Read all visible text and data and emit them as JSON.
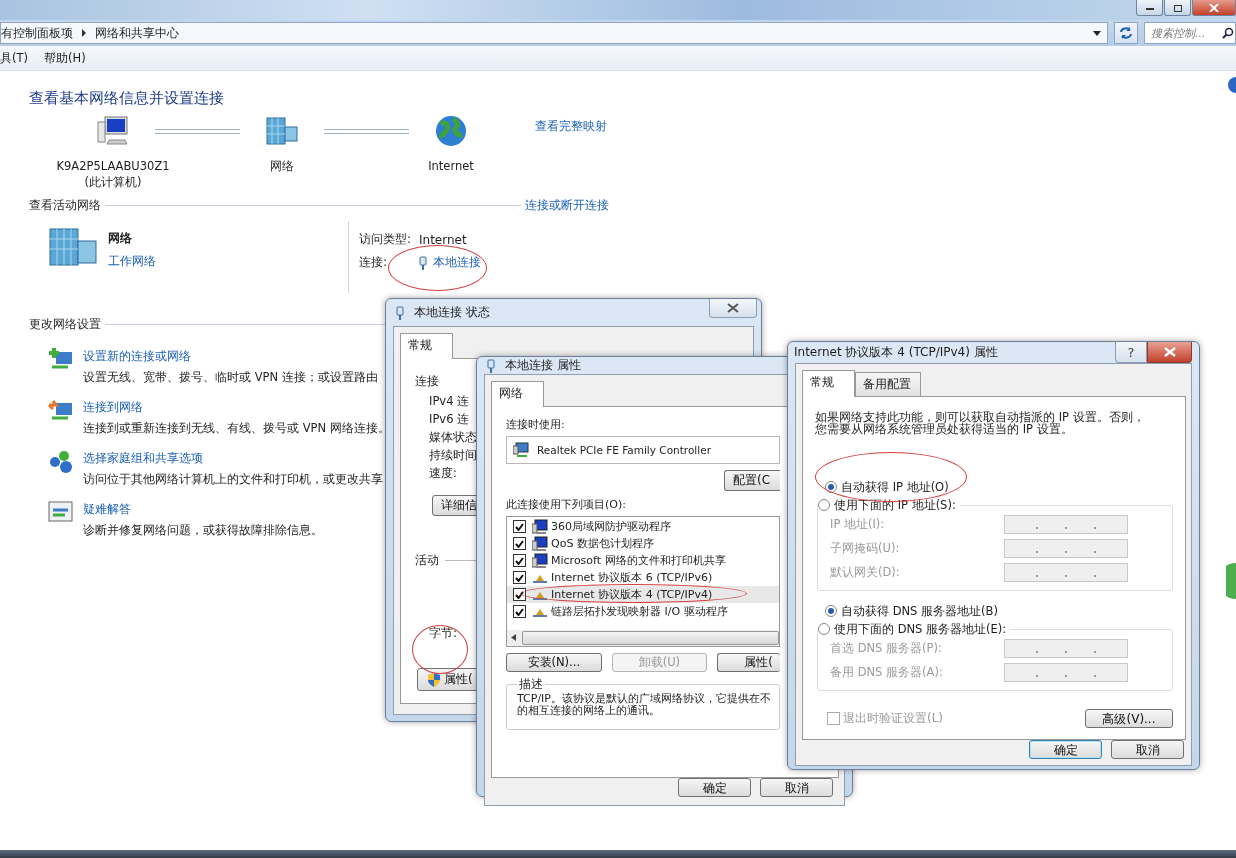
{
  "window": {
    "breadcrumb": [
      "有控制面板项",
      "网络和共享中心"
    ],
    "search": {
      "placeholder": "搜索控制..."
    },
    "menu": [
      "具(T)",
      "帮助(H)"
    ]
  },
  "page": {
    "title": "查看基本网络信息并设置连接",
    "map": [
      {
        "kind": "computer",
        "label": "K9A2P5LAABU30Z1",
        "sublabel": "(此计算机)"
      },
      {
        "kind": "network",
        "label": "网络"
      },
      {
        "kind": "globe",
        "label": "Internet"
      }
    ],
    "map_link": "查看完整映射",
    "active_heading": "查看活动网络",
    "active_link": "连接或断开连接",
    "network": {
      "name": "网络",
      "type": "工作网络"
    },
    "access": [
      {
        "kind": "text",
        "label": "访问类型:",
        "value": "Internet"
      },
      {
        "kind": "link",
        "label": "连接:",
        "value": "本地连接"
      }
    ],
    "change_heading": "更改网络设置",
    "tasks": [
      {
        "kind": "new",
        "title": "设置新的连接或网络",
        "desc": "设置无线、宽带、拨号、临时或 VPN 连接；或设置路由"
      },
      {
        "kind": "connect",
        "title": "连接到网络",
        "desc": "连接到或重新连接到无线、有线、拨号或 VPN 网络连接。"
      },
      {
        "kind": "homegroup",
        "title": "选择家庭组和共享选项",
        "desc": "访问位于其他网络计算机上的文件和打印机，或更改共享"
      },
      {
        "kind": "troubleshoot",
        "title": "疑难解答",
        "desc": "诊断并修复网络问题，或获得故障排除信息。"
      }
    ]
  },
  "status_dialog": {
    "title": "本地连接 状态",
    "tabs": [
      {
        "label": "常规",
        "selected": true
      }
    ],
    "section": "连接",
    "fields": [
      "IPv4 连",
      "IPv6 连",
      "媒体状态",
      "持续时间",
      "速度:"
    ],
    "details_button": "详细信",
    "activity": "活动",
    "bytes": "字节:",
    "properties_button": "属性("
  },
  "props_dialog": {
    "title": "本地连接 属性",
    "tabs": [
      {
        "label": "网络",
        "selected": true
      }
    ],
    "connect_using": "连接时使用:",
    "adapter": "Realtek PCIe FE Family Controller",
    "configure_button": "配置(C",
    "items_label": "此连接使用下列项目(O):",
    "items": [
      {
        "kind": "client",
        "label": "360局域网防护驱动程序",
        "checked": true,
        "selected": false
      },
      {
        "kind": "client",
        "label": "QoS 数据包计划程序",
        "checked": true,
        "selected": false
      },
      {
        "kind": "client",
        "label": "Microsoft 网络的文件和打印机共享",
        "checked": true,
        "selected": false
      },
      {
        "kind": "protocol",
        "label": "Internet 协议版本 6 (TCP/IPv6)",
        "checked": true,
        "selected": false
      },
      {
        "kind": "protocol",
        "label": "Internet 协议版本 4 (TCP/IPv4)",
        "checked": true,
        "selected": true
      },
      {
        "kind": "protocol",
        "label": "链路层拓扑发现映射器 I/O 驱动程序",
        "checked": true,
        "selected": false
      }
    ],
    "buttons": [
      {
        "label": "安装(N)...",
        "disabled": false
      },
      {
        "label": "卸载(U)",
        "disabled": true
      },
      {
        "label": "属性(",
        "disabled": false
      }
    ],
    "desc_label": "描述",
    "desc": [
      "TCP/IP。该协议是默认的广域网络协议，它提供在不",
      "的相互连接的网络上的通讯。"
    ],
    "ok": "确定",
    "cancel": "取消"
  },
  "ipv4_dialog": {
    "title": "Internet 协议版本 4 (TCP/IPv4) 属性",
    "help": "?",
    "tabs": [
      {
        "label": "常规",
        "selected": true
      },
      {
        "label": "备用配置",
        "selected": false
      }
    ],
    "intro": [
      "如果网络支持此功能，则可以获取自动指派的 IP 设置。否则，",
      "您需要从网络系统管理员处获得适当的 IP 设置。"
    ],
    "ip_auto": {
      "label": "自动获得 IP 地址(O)",
      "selected": true
    },
    "ip_manual": {
      "label": "使用下面的 IP 地址(S):",
      "selected": false
    },
    "ip_fields": [
      {
        "label": "IP 地址(I):",
        "disabled": true
      },
      {
        "label": "子网掩码(U):",
        "disabled": true
      },
      {
        "label": "默认网关(D):",
        "disabled": true
      }
    ],
    "dns_auto": {
      "label": "自动获得 DNS 服务器地址(B)",
      "selected": true
    },
    "dns_manual": {
      "label": "使用下面的 DNS 服务器地址(E):",
      "selected": false
    },
    "dns_fields": [
      {
        "label": "首选 DNS 服务器(P):",
        "disabled": true
      },
      {
        "label": "备用 DNS 服务器(A):",
        "disabled": true
      }
    ],
    "validate": {
      "label": "退出时验证设置(L)",
      "checked": false,
      "disabled": true
    },
    "advanced": "高级(V)...",
    "ok": "确定",
    "cancel": "取消"
  }
}
